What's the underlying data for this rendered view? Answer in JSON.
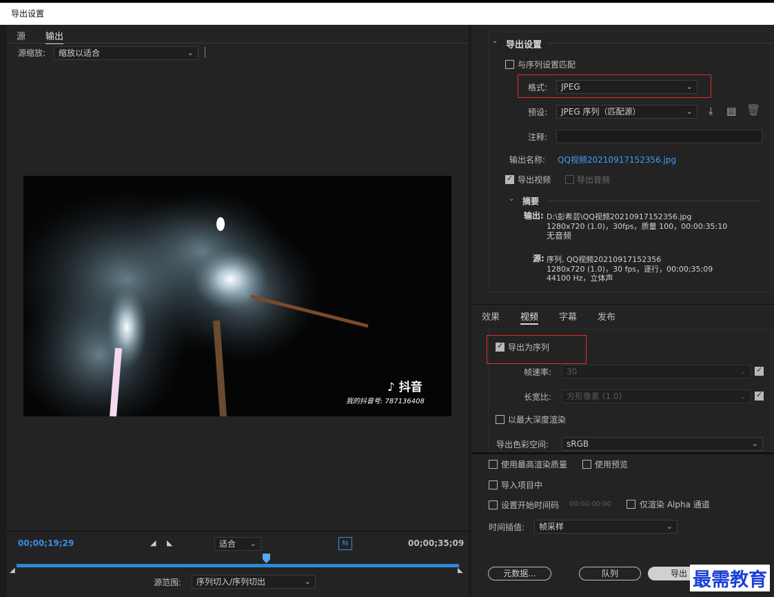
{
  "window": {
    "title": "导出设置"
  },
  "left": {
    "tabs": [
      "源",
      "输出"
    ],
    "active_tab": "输出",
    "source_scale_label": "源缩放:",
    "source_scale_value": "缩放以适合",
    "watermark_app": "抖音",
    "watermark_id": "我的抖音号: 787136408"
  },
  "timeline": {
    "current_time": "00;00;19;29",
    "end_time": "00;00;35;09",
    "fit_value": "适合",
    "source_range_label": "源范围:",
    "source_range_value": "序列切入/序列切出"
  },
  "export_settings": {
    "section_title": "导出设置",
    "match_sequence_label": "与序列设置匹配",
    "format_label": "格式:",
    "format_value": "JPEG",
    "preset_label": "预设:",
    "preset_value": "JPEG 序列（匹配源）",
    "comment_label": "注释:",
    "output_name_label": "输出名称:",
    "output_name_value": "QQ视频20210917152356.jpg",
    "export_video_label": "导出视频",
    "export_audio_label": "导出音频"
  },
  "summary": {
    "title": "摘要",
    "output_label": "输出:",
    "output_line1": "D:\\彭希芸\\QQ视频20210917152356.jpg",
    "output_line2": "1280x720 (1.0)，30fps，质量 100，00:00:35:10",
    "output_line3": "无音频",
    "source_label": "源:",
    "source_line1": "序列, QQ视频20210917152356",
    "source_line2": "1280x720 (1.0)，30 fps，逐行，00;00;35;09",
    "source_line3": "44100 Hz，立体声"
  },
  "tabs_bottom": {
    "items": [
      "效果",
      "视频",
      "字幕",
      "发布"
    ],
    "active": "视频"
  },
  "video": {
    "export_as_sequence_label": "导出为序列",
    "frame_rate_label": "帧速率:",
    "frame_rate_value": "30",
    "aspect_label": "长宽比:",
    "aspect_value": "方形像素 (1.0)",
    "max_depth_label": "以最大深度渲染",
    "color_space_label": "导出色彩空间:",
    "color_space_value": "sRGB"
  },
  "bottom": {
    "max_render_label": "使用最高渲染质量",
    "use_preview_label": "使用预览",
    "import_project_label": "导入项目中",
    "set_start_tc_label": "设置开始时间码",
    "start_tc_value": "00:00:00:00",
    "alpha_only_label": "仅渲染 Alpha 通道",
    "time_interp_label": "时间插值:",
    "time_interp_value": "帧采样",
    "metadata_button": "元数据...",
    "queue_button": "队列",
    "export_button": "导出"
  },
  "overlay_watermark": "最需教育"
}
